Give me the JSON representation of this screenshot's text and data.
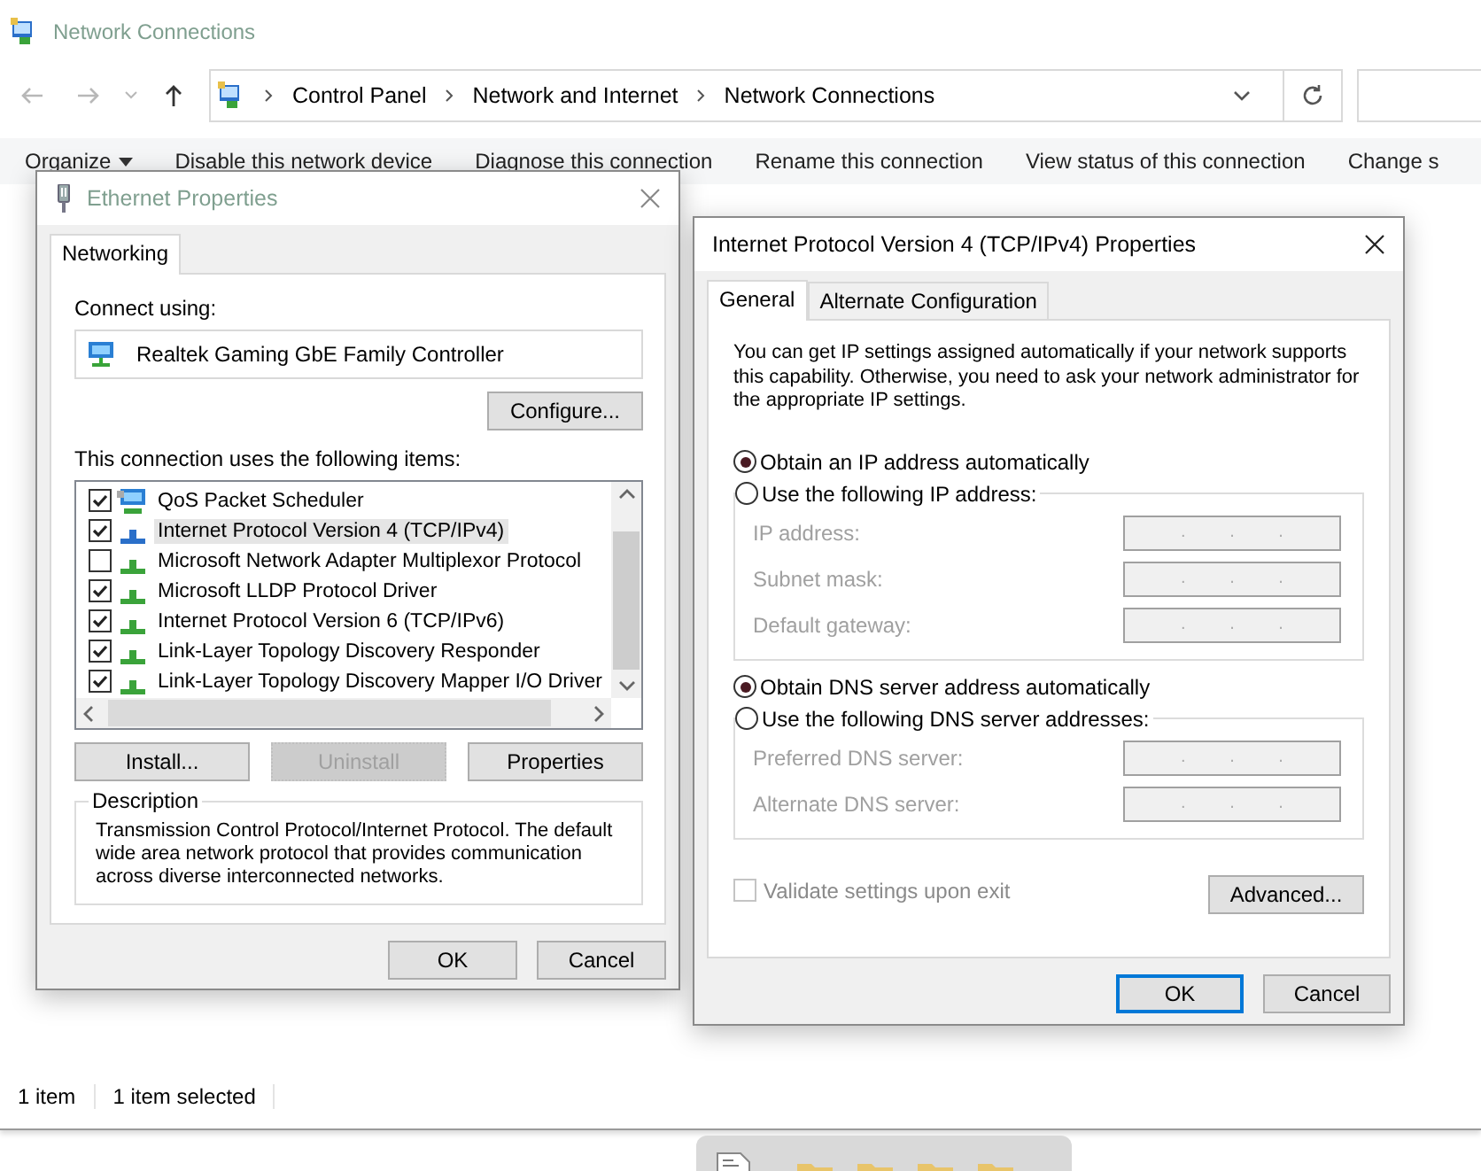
{
  "explorer": {
    "title": "Network Connections",
    "address_path": [
      "Control Panel",
      "Network and Internet",
      "Network Connections"
    ],
    "command_bar": [
      {
        "label": "Organize",
        "kind": "menu"
      },
      {
        "label": "Disable this network device",
        "kind": "action"
      },
      {
        "label": "Diagnose this connection",
        "kind": "action"
      },
      {
        "label": "Rename this connection",
        "kind": "action"
      },
      {
        "label": "View status of this connection",
        "kind": "action"
      },
      {
        "label": "Change s",
        "kind": "action"
      }
    ],
    "status_bar": [
      "1 item",
      "1 item selected"
    ]
  },
  "ethernet_dialog": {
    "title": "Ethernet Properties",
    "tabs": [
      {
        "label": "Networking",
        "selected": true
      }
    ],
    "connect_using_label": "Connect using:",
    "adapter": "Realtek Gaming GbE Family Controller",
    "configure_button": "Configure...",
    "items_label": "This connection uses the following items:",
    "items": [
      {
        "label": "QoS Packet Scheduler",
        "kind": "service",
        "checked": true,
        "selected": false
      },
      {
        "label": "Internet Protocol Version 4 (TCP/IPv4)",
        "kind": "protocol",
        "checked": true,
        "selected": true
      },
      {
        "label": "Microsoft Network Adapter Multiplexor Protocol",
        "kind": "protocol",
        "checked": false,
        "selected": false
      },
      {
        "label": "Microsoft LLDP Protocol Driver",
        "kind": "protocol",
        "checked": true,
        "selected": false
      },
      {
        "label": "Internet Protocol Version 6 (TCP/IPv6)",
        "kind": "protocol",
        "checked": true,
        "selected": false
      },
      {
        "label": "Link-Layer Topology Discovery Responder",
        "kind": "protocol",
        "checked": true,
        "selected": false
      },
      {
        "label": "Link-Layer Topology Discovery Mapper I/O Driver",
        "kind": "protocol",
        "checked": true,
        "selected": false
      }
    ],
    "buttons": [
      {
        "label": "Install...",
        "disabled": false
      },
      {
        "label": "Uninstall",
        "disabled": true
      },
      {
        "label": "Properties",
        "disabled": false
      }
    ],
    "description": {
      "title": "Description",
      "text": "Transmission Control Protocol/Internet Protocol. The default wide area network protocol that provides communication across diverse interconnected networks."
    },
    "footer_buttons": [
      {
        "label": "OK",
        "default": false
      },
      {
        "label": "Cancel",
        "default": false
      }
    ]
  },
  "ipv4_dialog": {
    "title": "Internet Protocol Version 4 (TCP/IPv4) Properties",
    "tabs": [
      {
        "label": "General",
        "selected": true
      },
      {
        "label": "Alternate Configuration",
        "selected": false
      }
    ],
    "intro": "You can get IP settings assigned automatically if your network supports this capability. Otherwise, you need to ask your network administrator for the appropriate IP settings.",
    "ip_options": [
      {
        "label": "Obtain an IP address automatically",
        "selected": true
      },
      {
        "label": "Use the following IP address:",
        "selected": false
      }
    ],
    "ip_fields": [
      {
        "label": "IP address:",
        "value": ". . .",
        "disabled": true
      },
      {
        "label": "Subnet mask:",
        "value": ". . .",
        "disabled": true
      },
      {
        "label": "Default gateway:",
        "value": ". . .",
        "disabled": true
      }
    ],
    "dns_options": [
      {
        "label": "Obtain DNS server address automatically",
        "selected": true
      },
      {
        "label": "Use the following DNS server addresses:",
        "selected": false
      }
    ],
    "dns_fields": [
      {
        "label": "Preferred DNS server:",
        "value": ". . .",
        "disabled": true
      },
      {
        "label": "Alternate DNS server:",
        "value": ". . .",
        "disabled": true
      }
    ],
    "validate": {
      "label": "Validate settings upon exit",
      "checked": false,
      "disabled": true
    },
    "advanced_button": "Advanced...",
    "footer_buttons": [
      {
        "label": "OK",
        "default": true
      },
      {
        "label": "Cancel",
        "default": false
      }
    ]
  }
}
